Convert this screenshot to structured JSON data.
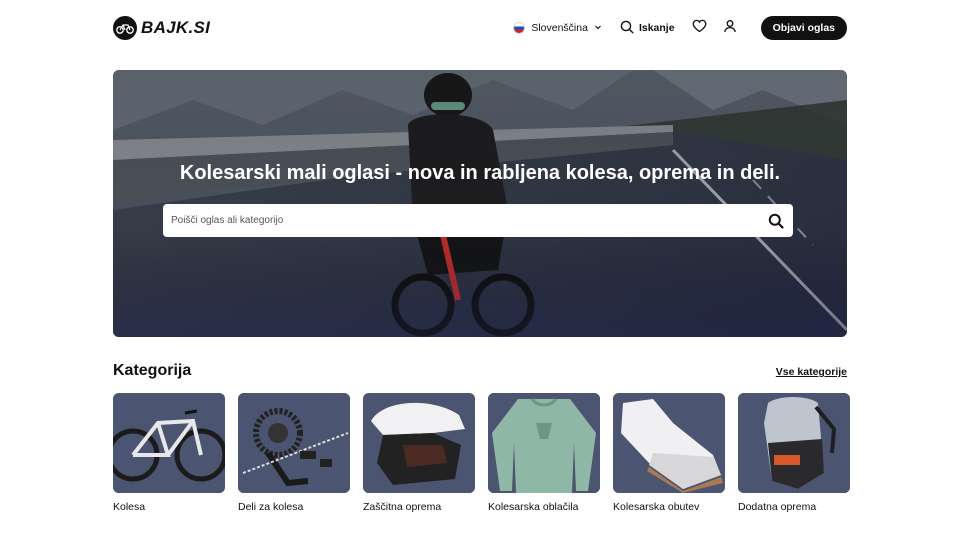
{
  "header": {
    "logo_text": "BAJK.SI",
    "language": "Slovenščina",
    "search_label": "Iskanje",
    "publish_label": "Objavi oglas"
  },
  "hero": {
    "title": "Kolesarski mali oglasi - nova in rabljena kolesa, oprema in deli.",
    "search_placeholder": "Poišči oglas ali kategorijo"
  },
  "categories": {
    "title": "Kategorija",
    "all_link": "Vse kategorije",
    "items": [
      {
        "label": "Kolesa"
      },
      {
        "label": "Deli za kolesa"
      },
      {
        "label": "Zaščitna oprema"
      },
      {
        "label": "Kolesarska oblačila"
      },
      {
        "label": "Kolesarska obutev"
      },
      {
        "label": "Dodatna oprema"
      }
    ]
  }
}
